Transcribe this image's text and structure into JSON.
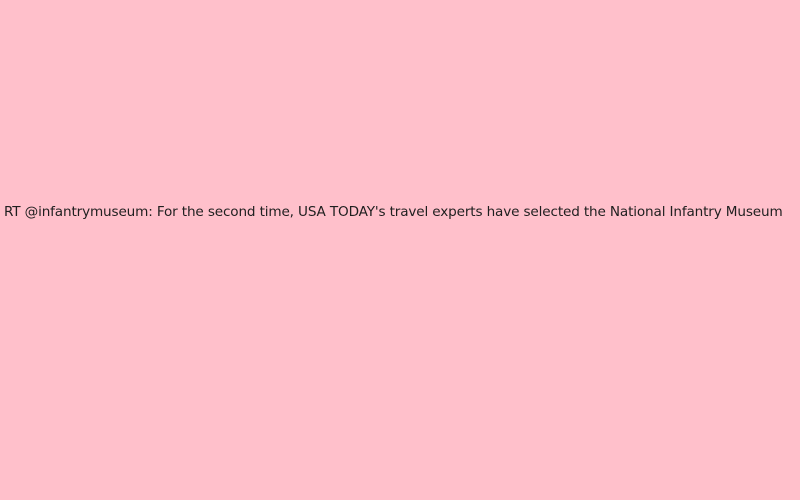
{
  "background_color": "#ffc0cb",
  "text_color": "#1f1f1f",
  "tweet": {
    "text": "RT @infantrymuseum: For the second time, USA TODAY's travel experts have selected the National Infantry Museum"
  }
}
